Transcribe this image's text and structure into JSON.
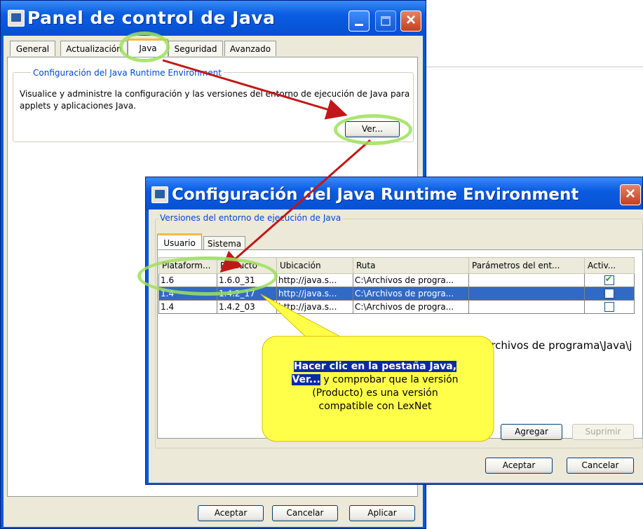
{
  "control_panel": {
    "title": "Panel de control de Java",
    "tabs": [
      {
        "label": "General"
      },
      {
        "label": "Actualización"
      },
      {
        "label": "Java"
      },
      {
        "label": "Seguridad"
      },
      {
        "label": "Avanzado"
      }
    ],
    "active_tab": "Java",
    "group_title": "Configuración del Java Runtime Environment",
    "description": "Visualice y administre la configuración y las versiones del entorno de ejecución de Java para applets y aplicaciones Java.",
    "view_button": "Ver...",
    "footer": {
      "accept": "Aceptar",
      "cancel": "Cancelar",
      "apply": "Aplicar"
    }
  },
  "jre_dialog": {
    "title": "Configuración del Java Runtime Environment",
    "group_title": "Versiones del entorno de ejecución de Java",
    "tabs": [
      {
        "label": "Usuario"
      },
      {
        "label": "Sistema"
      }
    ],
    "columns": [
      "Plataform...",
      "Producto",
      "Ubicación",
      "Ruta",
      "Parámetros del ent...",
      "Activ..."
    ],
    "rows": [
      {
        "platform": "1.6",
        "product": "1.6.0_31",
        "location": "http://java.s...",
        "path": "C:\\Archivos de progra...",
        "params": "",
        "enabled": true
      },
      {
        "platform": "1.4",
        "product": "1.4.2_17",
        "location": "http://java.s...",
        "path": "C:\\Archivos de progra...",
        "params": "",
        "enabled": false
      },
      {
        "platform": "1.4",
        "product": "1.4.2_03",
        "location": "http://java.s...",
        "path": "C:\\Archivos de progra...",
        "params": "",
        "enabled": false
      }
    ],
    "path_tooltip": "Archivos de programa\\Java\\j",
    "add_button": "Agregar",
    "remove_button": "Suprimir",
    "accept_button": "Aceptar",
    "cancel_button": "Cancelar"
  },
  "callout": {
    "highlight1": "Hacer clic en la pestaña Java,",
    "highlight2": "Ver...",
    "text1": " y comprobar que la versión",
    "text2": "(Producto) es una versión",
    "text3": "compatible con LexNet",
    "fill_color": "#ffff4a",
    "arrow_color": "#c01818",
    "ring_color": "#9ee05a"
  }
}
